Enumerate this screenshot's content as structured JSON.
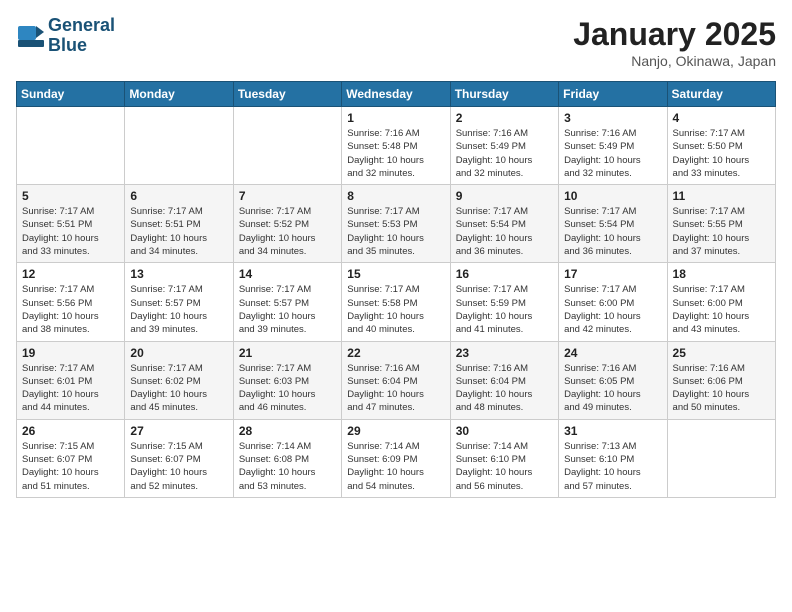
{
  "header": {
    "logo_line1": "General",
    "logo_line2": "Blue",
    "month": "January 2025",
    "location": "Nanjo, Okinawa, Japan"
  },
  "days_of_week": [
    "Sunday",
    "Monday",
    "Tuesday",
    "Wednesday",
    "Thursday",
    "Friday",
    "Saturday"
  ],
  "weeks": [
    [
      {
        "day": "",
        "info": ""
      },
      {
        "day": "",
        "info": ""
      },
      {
        "day": "",
        "info": ""
      },
      {
        "day": "1",
        "info": "Sunrise: 7:16 AM\nSunset: 5:48 PM\nDaylight: 10 hours\nand 32 minutes."
      },
      {
        "day": "2",
        "info": "Sunrise: 7:16 AM\nSunset: 5:49 PM\nDaylight: 10 hours\nand 32 minutes."
      },
      {
        "day": "3",
        "info": "Sunrise: 7:16 AM\nSunset: 5:49 PM\nDaylight: 10 hours\nand 32 minutes."
      },
      {
        "day": "4",
        "info": "Sunrise: 7:17 AM\nSunset: 5:50 PM\nDaylight: 10 hours\nand 33 minutes."
      }
    ],
    [
      {
        "day": "5",
        "info": "Sunrise: 7:17 AM\nSunset: 5:51 PM\nDaylight: 10 hours\nand 33 minutes."
      },
      {
        "day": "6",
        "info": "Sunrise: 7:17 AM\nSunset: 5:51 PM\nDaylight: 10 hours\nand 34 minutes."
      },
      {
        "day": "7",
        "info": "Sunrise: 7:17 AM\nSunset: 5:52 PM\nDaylight: 10 hours\nand 34 minutes."
      },
      {
        "day": "8",
        "info": "Sunrise: 7:17 AM\nSunset: 5:53 PM\nDaylight: 10 hours\nand 35 minutes."
      },
      {
        "day": "9",
        "info": "Sunrise: 7:17 AM\nSunset: 5:54 PM\nDaylight: 10 hours\nand 36 minutes."
      },
      {
        "day": "10",
        "info": "Sunrise: 7:17 AM\nSunset: 5:54 PM\nDaylight: 10 hours\nand 36 minutes."
      },
      {
        "day": "11",
        "info": "Sunrise: 7:17 AM\nSunset: 5:55 PM\nDaylight: 10 hours\nand 37 minutes."
      }
    ],
    [
      {
        "day": "12",
        "info": "Sunrise: 7:17 AM\nSunset: 5:56 PM\nDaylight: 10 hours\nand 38 minutes."
      },
      {
        "day": "13",
        "info": "Sunrise: 7:17 AM\nSunset: 5:57 PM\nDaylight: 10 hours\nand 39 minutes."
      },
      {
        "day": "14",
        "info": "Sunrise: 7:17 AM\nSunset: 5:57 PM\nDaylight: 10 hours\nand 39 minutes."
      },
      {
        "day": "15",
        "info": "Sunrise: 7:17 AM\nSunset: 5:58 PM\nDaylight: 10 hours\nand 40 minutes."
      },
      {
        "day": "16",
        "info": "Sunrise: 7:17 AM\nSunset: 5:59 PM\nDaylight: 10 hours\nand 41 minutes."
      },
      {
        "day": "17",
        "info": "Sunrise: 7:17 AM\nSunset: 6:00 PM\nDaylight: 10 hours\nand 42 minutes."
      },
      {
        "day": "18",
        "info": "Sunrise: 7:17 AM\nSunset: 6:00 PM\nDaylight: 10 hours\nand 43 minutes."
      }
    ],
    [
      {
        "day": "19",
        "info": "Sunrise: 7:17 AM\nSunset: 6:01 PM\nDaylight: 10 hours\nand 44 minutes."
      },
      {
        "day": "20",
        "info": "Sunrise: 7:17 AM\nSunset: 6:02 PM\nDaylight: 10 hours\nand 45 minutes."
      },
      {
        "day": "21",
        "info": "Sunrise: 7:17 AM\nSunset: 6:03 PM\nDaylight: 10 hours\nand 46 minutes."
      },
      {
        "day": "22",
        "info": "Sunrise: 7:16 AM\nSunset: 6:04 PM\nDaylight: 10 hours\nand 47 minutes."
      },
      {
        "day": "23",
        "info": "Sunrise: 7:16 AM\nSunset: 6:04 PM\nDaylight: 10 hours\nand 48 minutes."
      },
      {
        "day": "24",
        "info": "Sunrise: 7:16 AM\nSunset: 6:05 PM\nDaylight: 10 hours\nand 49 minutes."
      },
      {
        "day": "25",
        "info": "Sunrise: 7:16 AM\nSunset: 6:06 PM\nDaylight: 10 hours\nand 50 minutes."
      }
    ],
    [
      {
        "day": "26",
        "info": "Sunrise: 7:15 AM\nSunset: 6:07 PM\nDaylight: 10 hours\nand 51 minutes."
      },
      {
        "day": "27",
        "info": "Sunrise: 7:15 AM\nSunset: 6:07 PM\nDaylight: 10 hours\nand 52 minutes."
      },
      {
        "day": "28",
        "info": "Sunrise: 7:14 AM\nSunset: 6:08 PM\nDaylight: 10 hours\nand 53 minutes."
      },
      {
        "day": "29",
        "info": "Sunrise: 7:14 AM\nSunset: 6:09 PM\nDaylight: 10 hours\nand 54 minutes."
      },
      {
        "day": "30",
        "info": "Sunrise: 7:14 AM\nSunset: 6:10 PM\nDaylight: 10 hours\nand 56 minutes."
      },
      {
        "day": "31",
        "info": "Sunrise: 7:13 AM\nSunset: 6:10 PM\nDaylight: 10 hours\nand 57 minutes."
      },
      {
        "day": "",
        "info": ""
      }
    ]
  ]
}
